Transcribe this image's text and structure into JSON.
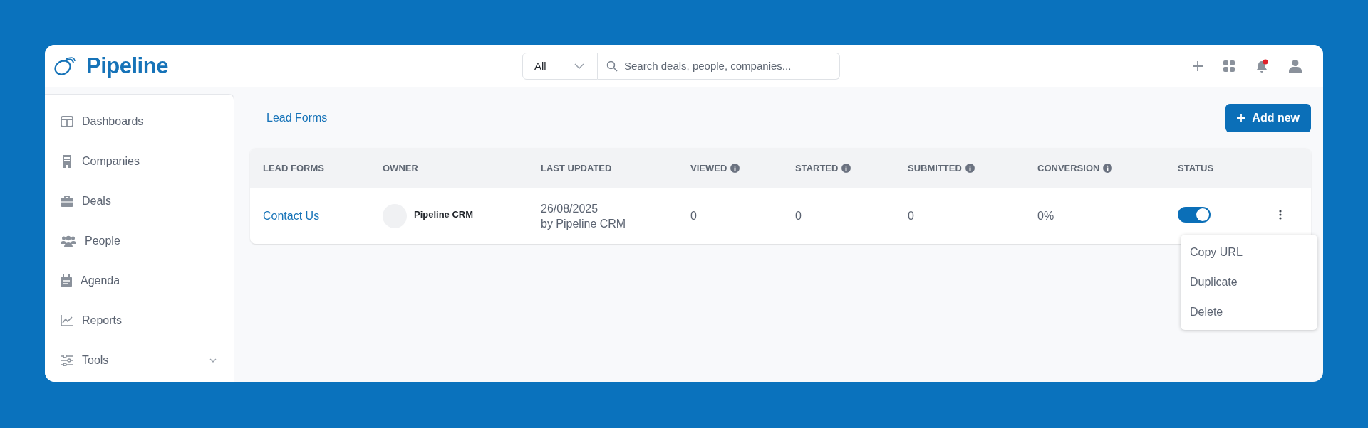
{
  "logo": {
    "text": "Pipeline"
  },
  "search": {
    "scope": "All",
    "placeholder": "Search deals, people, companies..."
  },
  "notifications": {
    "unread": true
  },
  "sidebar": {
    "items": [
      {
        "label": "Dashboards",
        "kind": "dashboard",
        "expandable": false
      },
      {
        "label": "Companies",
        "kind": "building",
        "expandable": false
      },
      {
        "label": "Deals",
        "kind": "briefcase",
        "expandable": false
      },
      {
        "label": "People",
        "kind": "people",
        "expandable": false
      },
      {
        "label": "Agenda",
        "kind": "calendar",
        "expandable": false
      },
      {
        "label": "Reports",
        "kind": "chart",
        "expandable": false
      },
      {
        "label": "Tools",
        "kind": "sliders",
        "expandable": true
      }
    ]
  },
  "breadcrumb": "Lead Forms",
  "add_button": "Add new",
  "table": {
    "columns": [
      {
        "label": "LEAD FORMS",
        "info": false
      },
      {
        "label": "OWNER",
        "info": false
      },
      {
        "label": "LAST UPDATED",
        "info": false
      },
      {
        "label": "VIEWED",
        "info": true
      },
      {
        "label": "STARTED",
        "info": true
      },
      {
        "label": "SUBMITTED",
        "info": true
      },
      {
        "label": "CONVERSION",
        "info": true
      },
      {
        "label": "STATUS",
        "info": false
      }
    ],
    "rows": [
      {
        "name": "Contact Us",
        "owner": "Pipeline CRM",
        "updated_date": "26/08/2025",
        "updated_by": "by Pipeline CRM",
        "viewed": "0",
        "started": "0",
        "submitted": "0",
        "conversion": "0%",
        "on": true
      }
    ]
  },
  "context_menu": {
    "items": [
      "Copy URL",
      "Duplicate",
      "Delete"
    ]
  }
}
